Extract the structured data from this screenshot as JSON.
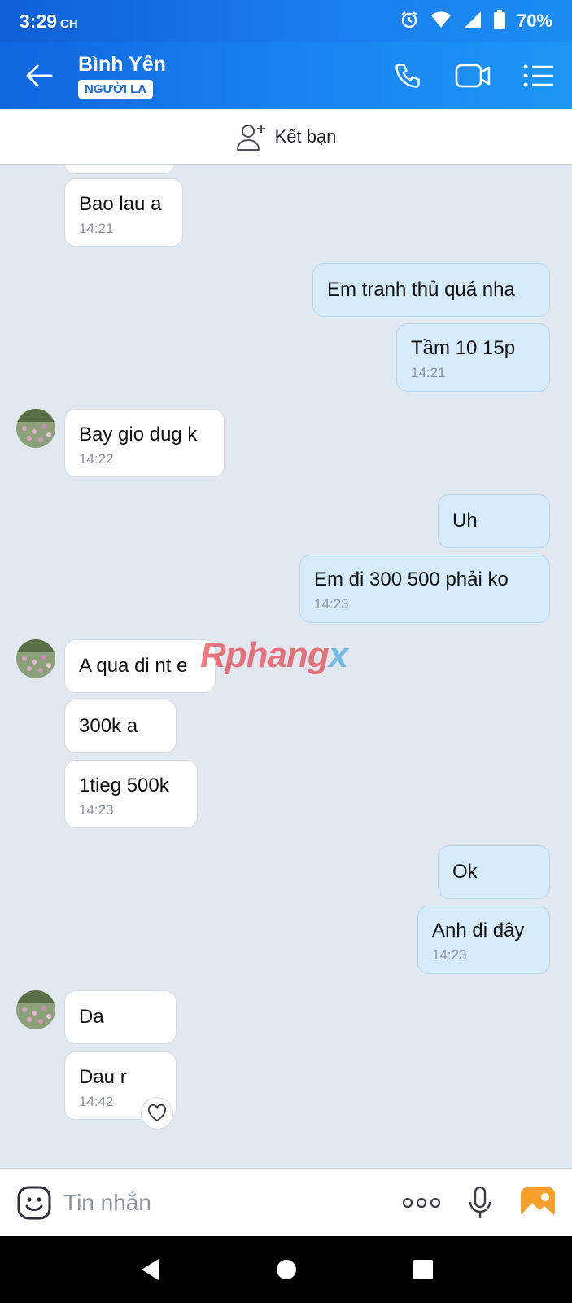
{
  "status_bar": {
    "time": "3:29",
    "ampm": "CH",
    "battery": "70%"
  },
  "header": {
    "title": "Bình Yên",
    "badge": "NGƯỜI LẠ"
  },
  "friend_bar": {
    "label": "Kết bạn"
  },
  "watermark": {
    "part1": "Rphang",
    "part2": "x"
  },
  "messages": [
    {
      "text": "Bao lau a",
      "time": "14:21"
    },
    {
      "text": "Em tranh thủ quá nha"
    },
    {
      "text": "Tầm 10 15p",
      "time": "14:21"
    },
    {
      "text": "Bay gio dug k",
      "time": "14:22"
    },
    {
      "text": "Uh"
    },
    {
      "text": "Em đi 300 500 phải ko",
      "time": "14:23"
    },
    {
      "text": "A qua di nt e"
    },
    {
      "text": "300k a"
    },
    {
      "text": "1tieg 500k",
      "time": "14:23"
    },
    {
      "text": "Ok"
    },
    {
      "text": "Anh đi đây",
      "time": "14:23"
    },
    {
      "text": "Da"
    },
    {
      "text": "Dau r",
      "time": "14:42"
    }
  ],
  "input": {
    "placeholder": "Tin nhắn"
  },
  "colors": {
    "accent": "#1a7ff0",
    "outgoing_bubble": "#d6ecfd",
    "chat_background": "#e2e8ef"
  }
}
